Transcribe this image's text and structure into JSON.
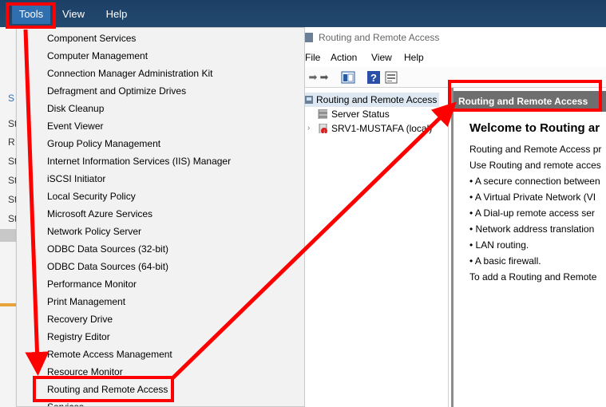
{
  "server_manager": {
    "menu": {
      "tools": "Tools",
      "view": "View",
      "help": "Help"
    },
    "sidebar_fragments": [
      "S",
      "St",
      "R",
      "St",
      "St",
      "St",
      "St"
    ]
  },
  "tools_menu": {
    "items": [
      "Component Services",
      "Computer Management",
      "Connection Manager Administration Kit",
      "Defragment and Optimize Drives",
      "Disk Cleanup",
      "Event Viewer",
      "Group Policy Management",
      "Internet Information Services (IIS) Manager",
      "iSCSI Initiator",
      "Local Security Policy",
      "Microsoft Azure Services",
      "Network Policy Server",
      "ODBC Data Sources (32-bit)",
      "ODBC Data Sources (64-bit)",
      "Performance Monitor",
      "Print Management",
      "Recovery Drive",
      "Registry Editor",
      "Remote Access Management",
      "Resource Monitor",
      "Routing and Remote Access",
      "Services"
    ],
    "highlighted": "Routing and Remote Access"
  },
  "rras_window": {
    "title": "Routing and Remote Access",
    "menu": {
      "file": "File",
      "action": "Action",
      "view": "View",
      "help": "Help"
    },
    "tree": {
      "root": "Routing and Remote Access",
      "server_status": "Server Status",
      "server": "SRV1-MUSTAFA (local)"
    },
    "detail": {
      "header": "Routing and Remote Access",
      "welcome": "Welcome to Routing ar",
      "lines": [
        "Routing and Remote Access pr",
        "Use Routing and remote acces",
        "• A secure connection between",
        "• A Virtual Private Network (VI",
        "• A Dial-up remote access ser",
        "• Network address translation",
        "• LAN routing.",
        "• A basic firewall.",
        "To add a Routing and Remote"
      ]
    }
  },
  "colors": {
    "annotation": "#ff0000",
    "topbar": "#1c3f66",
    "tools_active": "#2f6fb0",
    "detail_header": "#6e6e6e"
  }
}
